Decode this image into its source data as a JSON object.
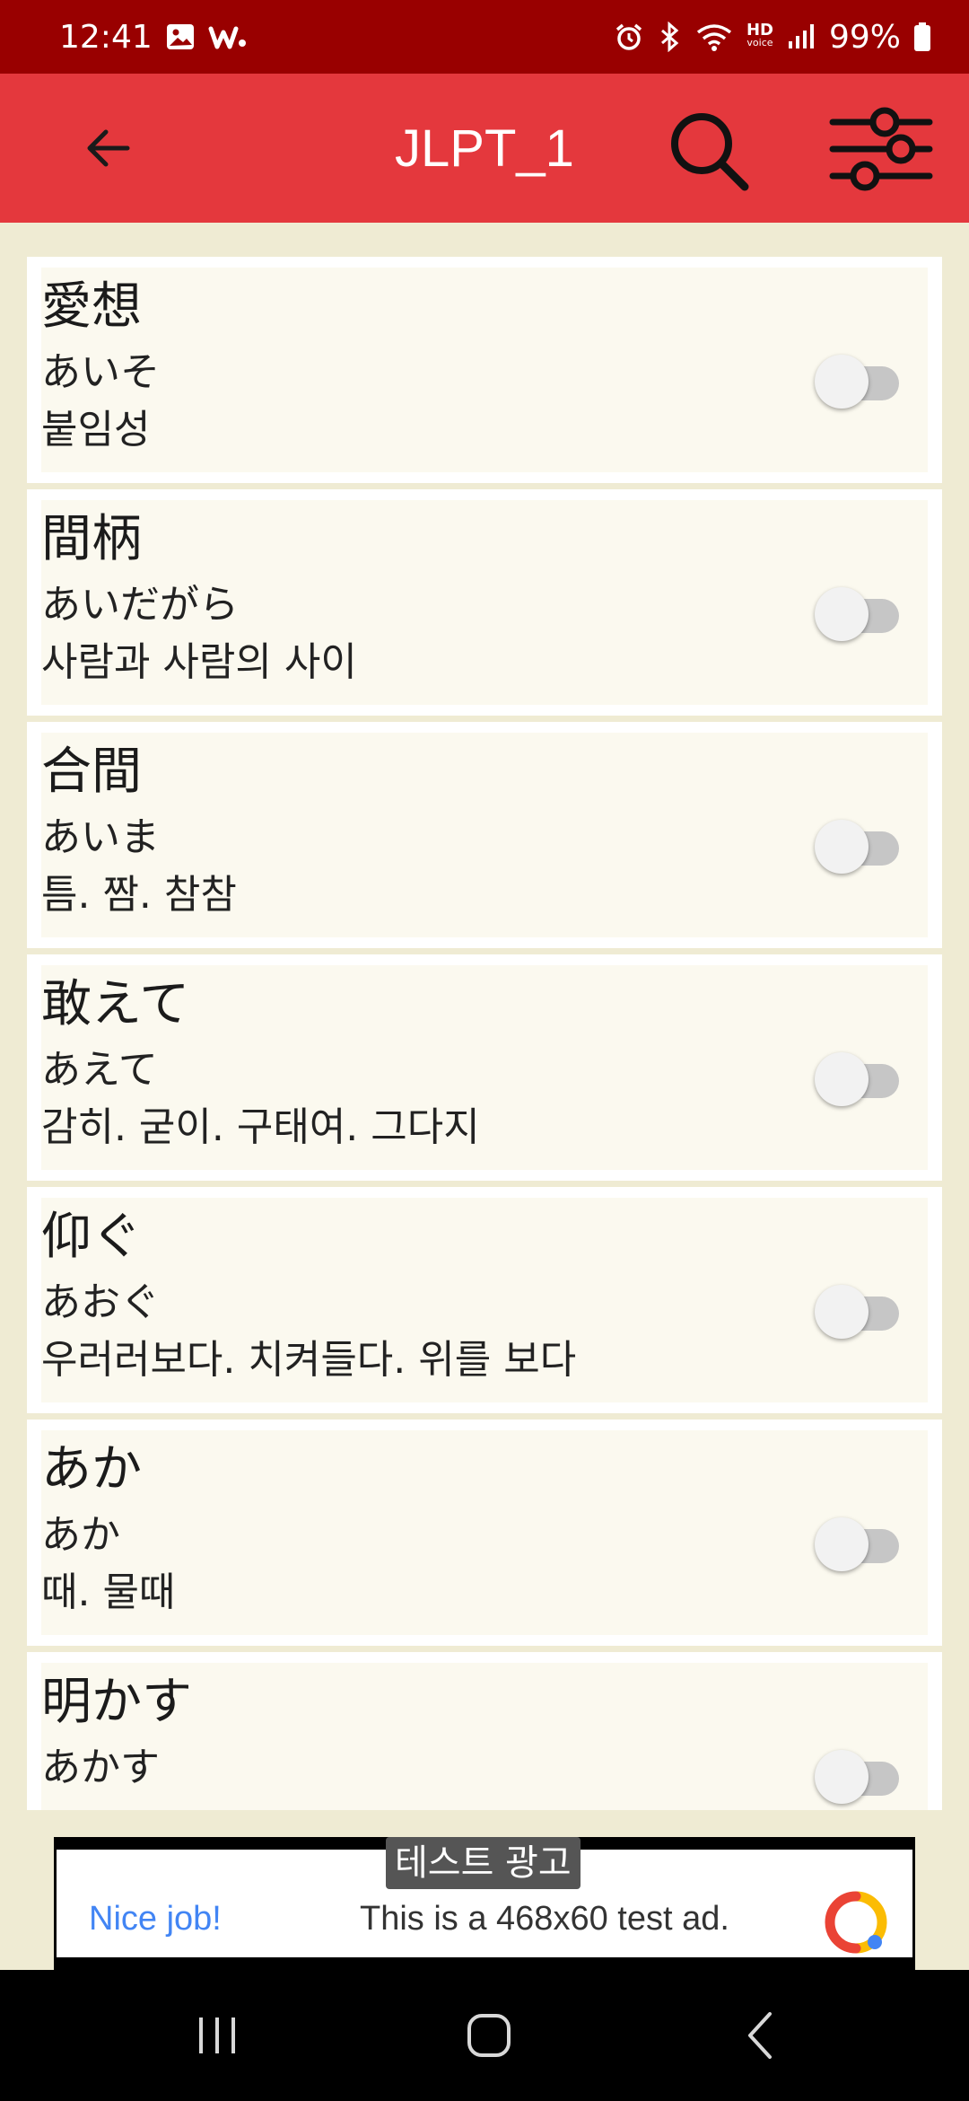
{
  "status_bar": {
    "time": "12:41",
    "battery": "99%",
    "left_icons": [
      "gallery-icon",
      "w-app-icon"
    ],
    "right_icons": [
      "alarm-icon",
      "bluetooth-icon",
      "wifi-icon",
      "hd-voice-icon",
      "signal-icon",
      "battery-icon"
    ],
    "hd_label": "HD",
    "voice_label": "voice"
  },
  "app_bar": {
    "title": "JLPT_1",
    "icons": [
      "back-arrow-icon",
      "search-icon",
      "filter-sliders-icon"
    ]
  },
  "words": [
    {
      "word": "愛想",
      "reading": "あいそ",
      "meaning": "붙임성",
      "enabled": false
    },
    {
      "word": "間柄",
      "reading": "あいだがら",
      "meaning": "사람과 사람의 사이",
      "enabled": false
    },
    {
      "word": "合間",
      "reading": "あいま",
      "meaning": "틈. 짬. 참참",
      "enabled": false
    },
    {
      "word": "敢えて",
      "reading": "あえて",
      "meaning": "감히. 굳이. 구태여. 그다지",
      "enabled": false
    },
    {
      "word": "仰ぐ",
      "reading": "あおぐ",
      "meaning": "우러러보다. 치켜들다. 위를 보다",
      "enabled": false
    },
    {
      "word": "あか",
      "reading": "あか",
      "meaning": "때. 물때",
      "enabled": false
    },
    {
      "word": "明かす",
      "reading": "あかす",
      "meaning": "",
      "enabled": false
    }
  ],
  "ad": {
    "label": "테스트 광고",
    "nice": "Nice job!",
    "text": "This is a 468x60 test ad."
  },
  "nav_bar": {
    "icons": [
      "recent-apps-icon",
      "home-icon",
      "back-icon"
    ]
  },
  "colors": {
    "status_bar": "#990000",
    "app_bar": "#e4383d",
    "background": "#efebd3",
    "card": "#fbf9ef"
  }
}
